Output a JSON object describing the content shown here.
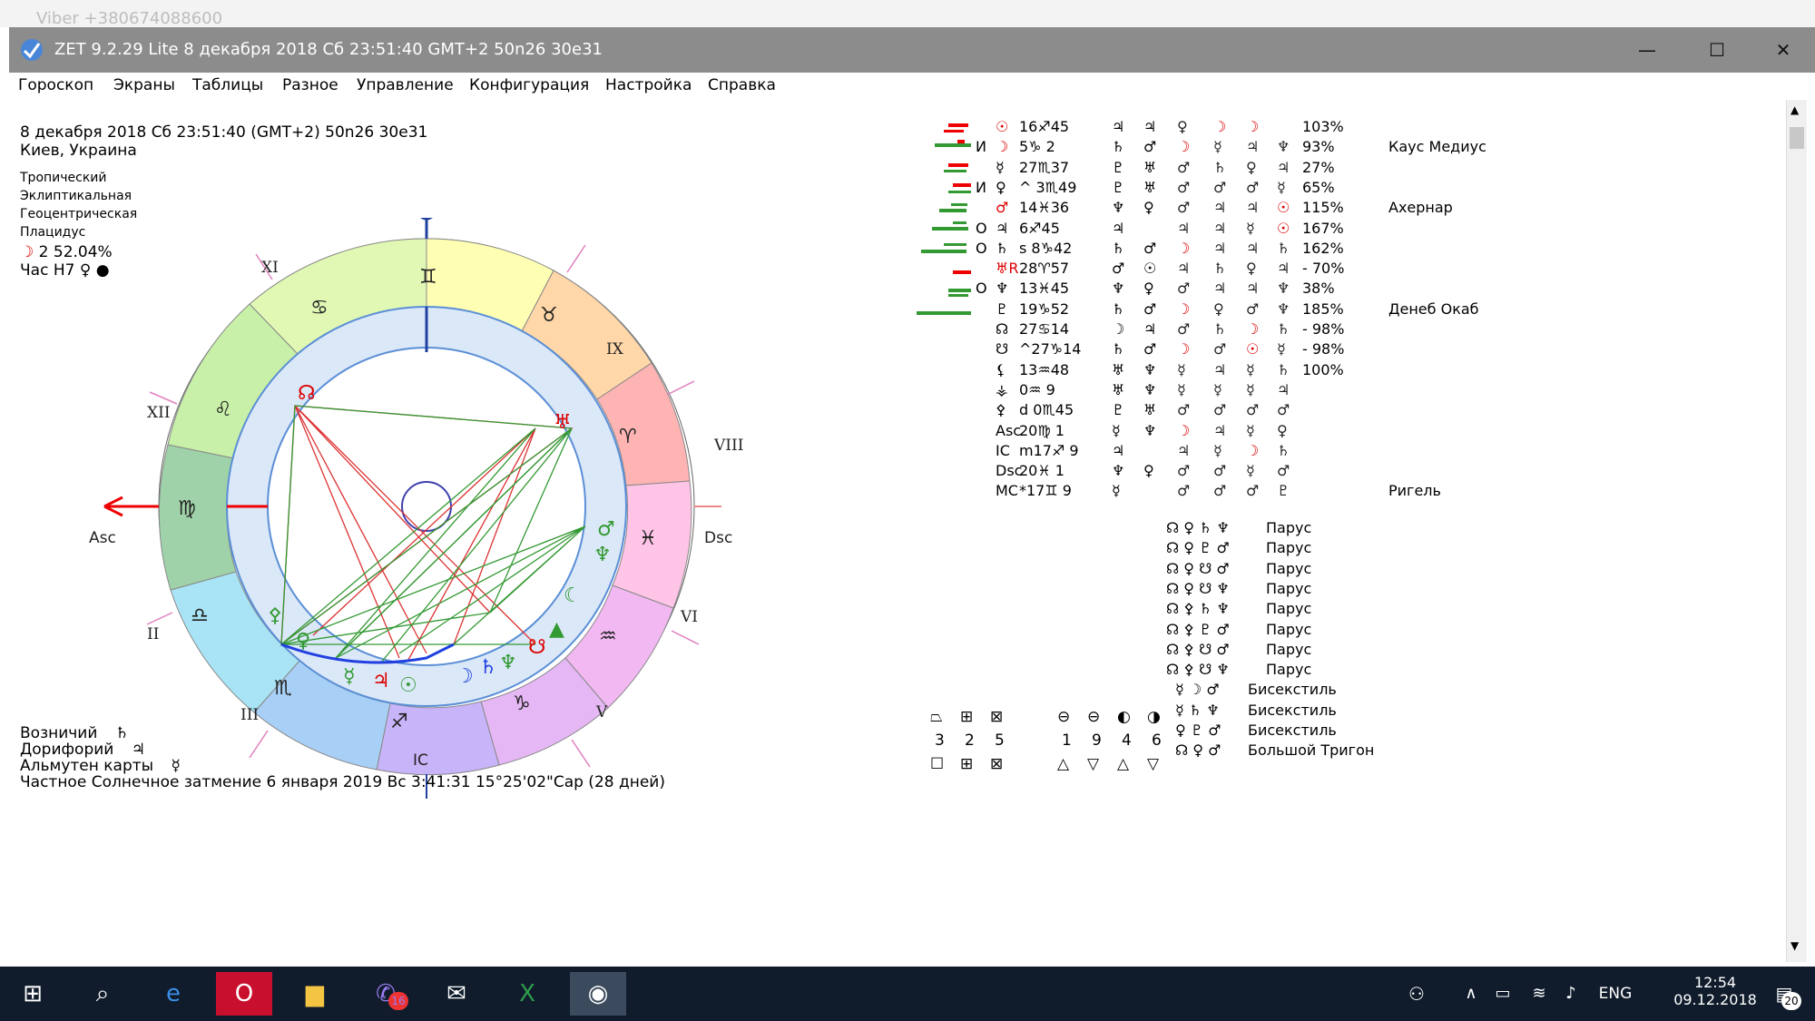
{
  "bg_window": {
    "title": "Viber +380674088600"
  },
  "window": {
    "title": "ZET 9.2.29 Lite    8 декабря 2018  Сб  23:51:40 GMT+2 50n26  30e31",
    "minimize": "—",
    "maximize": "☐",
    "close": "✕"
  },
  "menu": [
    "Гороскоп",
    "Экраны",
    "Таблицы",
    "Разное",
    "Управление",
    "Конфигурация",
    "Настройка",
    "Справка"
  ],
  "header": {
    "line1": "8 декабря 2018  Сб  23:51:40 (GMT+2) 50n26  30e31",
    "line2": "Киев, Украина",
    "p1": "Тропический",
    "p2": "Эклиптикальная",
    "p3": "Геоцентрическая",
    "p4": "Плацидус",
    "moon": "2 52.04%",
    "hour": "Час Н7"
  },
  "chart": {
    "axis_labels": {
      "mc": "MC",
      "ic": "IC",
      "asc": "Asc",
      "dsc": "Dsc"
    },
    "houses": [
      "XI",
      "IX",
      "XII",
      "VIII",
      "II",
      "VI",
      "III",
      "V"
    ],
    "signs": [
      "♊",
      "♉",
      "♋",
      "♈",
      "♌",
      "♓",
      "♍",
      "♒",
      "♎",
      "♑",
      "♏",
      "♐"
    ]
  },
  "planets_table": [
    {
      "flag": "",
      "sym": "☉",
      "pos": "16♐45",
      "c1": "♃",
      "c2": "♃",
      "c3": "♀",
      "c4": "☽",
      "c5": "☽",
      "pct": "103%",
      "star": ""
    },
    {
      "flag": "И",
      "sym": "☽",
      "pos": "5♑ 2",
      "c1": "♄",
      "c2": "♂",
      "c3": "☽",
      "c4": "☿",
      "c5": "♃",
      "c6": "♆",
      "pct": "93%",
      "star": "Каус Медиус"
    },
    {
      "flag": "",
      "sym": "☿",
      "pos": "27♏37",
      "c1": "♇",
      "c2": "♅",
      "c3": "♂",
      "c4": "♄",
      "c5": "♀",
      "c6": "♃",
      "pct": "27%",
      "star": ""
    },
    {
      "flag": "И",
      "sym": "♀",
      "pos": "^ 3♏49",
      "c1": "♇",
      "c2": "♅",
      "c3": "♂",
      "c4": "♂",
      "c5": "♂",
      "c6": "☿",
      "pct": "65%",
      "star": ""
    },
    {
      "flag": "",
      "sym": "♂",
      "pos": "14♓36",
      "c1": "♆",
      "c2": "♀",
      "c3": "♂",
      "c4": "♃",
      "c5": "♃",
      "c6": "☉",
      "pct": "115%",
      "star": "Ахернар"
    },
    {
      "flag": "О",
      "sym": "♃",
      "pos": "6♐45",
      "c1": "♃",
      "c2": "",
      "c3": "♃",
      "c4": "♃",
      "c5": "☿",
      "c6": "☉",
      "pct": "167%",
      "star": ""
    },
    {
      "flag": "О",
      "sym": "♄",
      "pos": "s 8♑42",
      "c1": "♄",
      "c2": "♂",
      "c3": "☽",
      "c4": "♃",
      "c5": "♃",
      "c6": "♄",
      "pct": "162%",
      "star": ""
    },
    {
      "flag": "",
      "sym": "♅R",
      "pos": "28♈57",
      "c1": "♂",
      "c2": "☉",
      "c3": "♃",
      "c4": "♄",
      "c5": "♀",
      "c6": "♃",
      "pct": "- 70%",
      "star": ""
    },
    {
      "flag": "О",
      "sym": "♆",
      "pos": "13♓45",
      "c1": "♆",
      "c2": "♀",
      "c3": "♂",
      "c4": "♃",
      "c5": "♃",
      "c6": "♆",
      "pct": "38%",
      "star": ""
    },
    {
      "flag": "",
      "sym": "♇",
      "pos": "19♑52",
      "c1": "♄",
      "c2": "♂",
      "c3": "☽",
      "c4": "♀",
      "c5": "♂",
      "c6": "♆",
      "pct": "185%",
      "star": "Денеб Окаб"
    },
    {
      "flag": "",
      "sym": "☊",
      "pos": "27♋14",
      "c1": "☽",
      "c2": "♃",
      "c3": "♂",
      "c4": "♄",
      "c5": "☽",
      "c6": "♄",
      "pct": "- 98%",
      "star": ""
    },
    {
      "flag": "",
      "sym": "☋",
      "pos": "^27♑14",
      "c1": "♄",
      "c2": "♂",
      "c3": "☽",
      "c4": "♂",
      "c5": "☉",
      "c6": "☿",
      "pct": "- 98%",
      "star": ""
    },
    {
      "flag": "",
      "sym": "⚸",
      "pos": "13♒48",
      "c1": "♅",
      "c2": "♆",
      "c3": "☿",
      "c4": "♃",
      "c5": "☿",
      "c6": "♄",
      "pct": "100%",
      "star": ""
    },
    {
      "flag": "",
      "sym": "⚶",
      "pos": "0♒ 9",
      "c1": "♅",
      "c2": "♆",
      "c3": "☿",
      "c4": "☿",
      "c5": "☿",
      "c6": "♃",
      "pct": "",
      "star": ""
    },
    {
      "flag": "",
      "sym": "⚴",
      "pos": "d 0♏45",
      "c1": "♇",
      "c2": "♅",
      "c3": "♂",
      "c4": "♂",
      "c5": "♂",
      "c6": "♂",
      "pct": "",
      "star": ""
    },
    {
      "flag": "",
      "sym": "Asc",
      "pos": "20♍ 1",
      "c1": "☿",
      "c2": "♆",
      "c3": "☽",
      "c4": "♃",
      "c5": "☿",
      "c6": "♀",
      "pct": "",
      "star": ""
    },
    {
      "flag": "",
      "sym": "IC",
      "pos": "m17♐ 9",
      "c1": "♃",
      "c2": "",
      "c3": "♃",
      "c4": "☿",
      "c5": "☽",
      "c6": "♄",
      "pct": "",
      "star": ""
    },
    {
      "flag": "",
      "sym": "Dsc",
      "pos": "20♓ 1",
      "c1": "♆",
      "c2": "♀",
      "c3": "♂",
      "c4": "♂",
      "c5": "☿",
      "c6": "♂",
      "pct": "",
      "star": ""
    },
    {
      "flag": "",
      "sym": "MC",
      "pos": "*17♊ 9",
      "c1": "☿",
      "c2": "",
      "c3": "♂",
      "c4": "♂",
      "c5": "♂",
      "c6": "♇",
      "pct": "",
      "star": "Ригель"
    }
  ],
  "configs": [
    {
      "syms": "☊ ♀ ♄ ♆",
      "name": "Парус"
    },
    {
      "syms": "☊ ♀ ♇ ♂",
      "name": "Парус"
    },
    {
      "syms": "☊ ♀ ☋ ♂",
      "name": "Парус"
    },
    {
      "syms": "☊ ♀ ☋ ♆",
      "name": "Парус"
    },
    {
      "syms": "☊ ⚴ ♄ ♆",
      "name": "Парус"
    },
    {
      "syms": "☊ ⚴ ♇ ♂",
      "name": "Парус"
    },
    {
      "syms": "☊ ⚴ ☋ ♂",
      "name": "Парус"
    },
    {
      "syms": "☊ ⚴ ☋ ♆",
      "name": "Парус"
    },
    {
      "syms": "☿ ☽ ♂",
      "name": "Бисекстиль"
    },
    {
      "syms": "☿ ♄ ♆",
      "name": "Бисекстиль"
    },
    {
      "syms": "♀ ♇ ♂",
      "name": "Бисекстиль"
    },
    {
      "syms": "☊ ♀ ♂",
      "name": "Большой Тригон"
    }
  ],
  "footer": {
    "l1": "Возничий",
    "l2": "Дорифорий",
    "l3": "Альмутен карты",
    "eclipse": "Частное Солнечное затмение 6 января 2019 Вс  3:41:31 15°25'02\"Сар (28 дней)"
  },
  "modality": {
    "row1": [
      "3",
      "2",
      "5"
    ],
    "row2": [
      "1",
      "9",
      "4",
      "6"
    ]
  },
  "taskbar": {
    "lang": "ENG",
    "time": "12:54",
    "date": "09.12.2018",
    "viber_badge": "16",
    "notif": "20"
  }
}
